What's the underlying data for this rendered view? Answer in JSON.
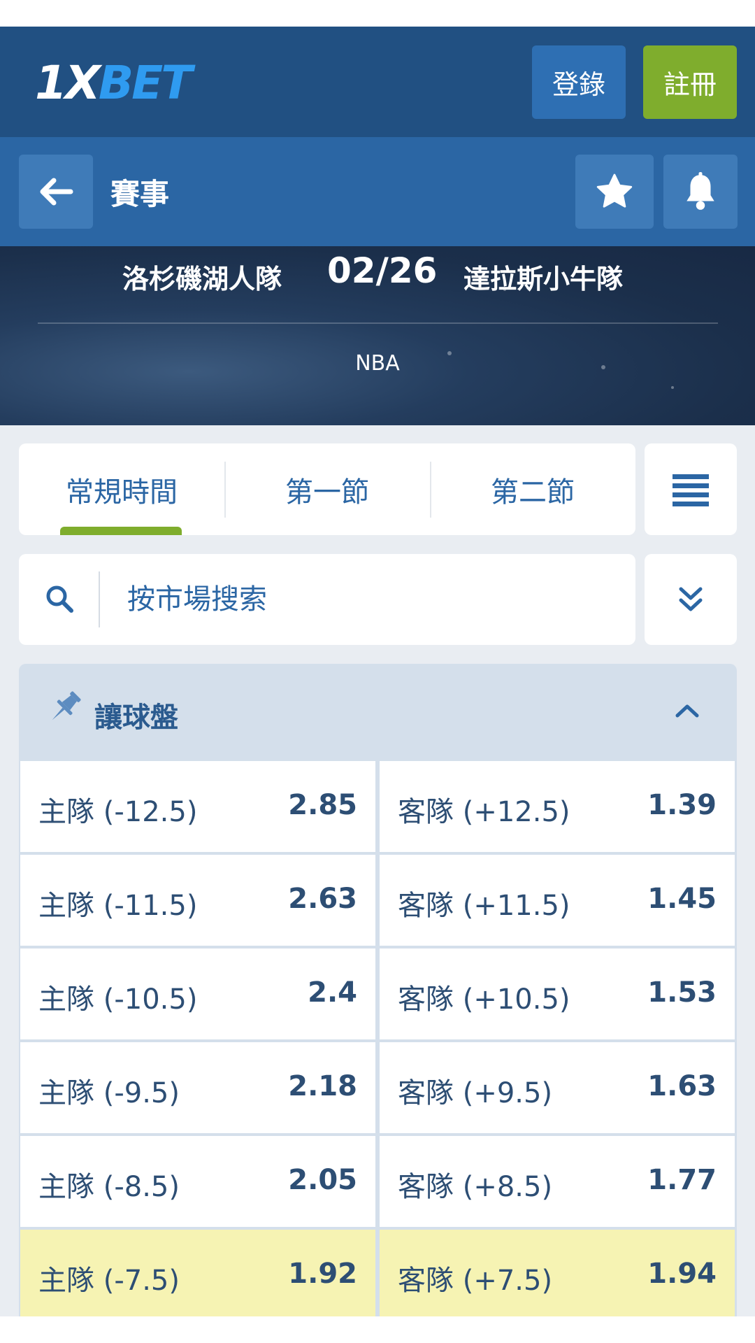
{
  "header": {
    "logo_one": "1X",
    "logo_bet": "BET",
    "login_label": "登錄",
    "register_label": "註冊"
  },
  "nav": {
    "title": "賽事",
    "back_icon": "arrow-left-icon",
    "favorite_icon": "star-icon",
    "notify_icon": "bell-icon"
  },
  "match": {
    "home_team": "洛杉磯湖人隊",
    "date": "02/26",
    "away_team": "達拉斯小牛隊",
    "league": "NBA"
  },
  "period_tabs": [
    {
      "label": "常規時間",
      "active": true
    },
    {
      "label": "第一節",
      "active": false
    },
    {
      "label": "第二節",
      "active": false
    }
  ],
  "search": {
    "placeholder": "按市場搜索"
  },
  "market": {
    "title": "讓球盤",
    "rows": [
      {
        "home_label": "主隊 (-12.5)",
        "home_odds": "2.85",
        "away_label": "客隊 (+12.5)",
        "away_odds": "1.39",
        "highlight": false
      },
      {
        "home_label": "主隊 (-11.5)",
        "home_odds": "2.63",
        "away_label": "客隊 (+11.5)",
        "away_odds": "1.45",
        "highlight": false
      },
      {
        "home_label": "主隊 (-10.5)",
        "home_odds": "2.4",
        "away_label": "客隊 (+10.5)",
        "away_odds": "1.53",
        "highlight": false
      },
      {
        "home_label": "主隊 (-9.5)",
        "home_odds": "2.18",
        "away_label": "客隊 (+9.5)",
        "away_odds": "1.63",
        "highlight": false
      },
      {
        "home_label": "主隊 (-8.5)",
        "home_odds": "2.05",
        "away_label": "客隊 (+8.5)",
        "away_odds": "1.77",
        "highlight": false
      },
      {
        "home_label": "主隊 (-7.5)",
        "home_odds": "1.92",
        "away_label": "客隊 (+7.5)",
        "away_odds": "1.94",
        "highlight": true
      }
    ]
  },
  "colors": {
    "brand_dark": "#215082",
    "brand": "#2b66a4",
    "accent_green": "#7fad2d",
    "highlight_yellow": "#f6f3b3",
    "text_dark_blue": "#2d4e74"
  }
}
